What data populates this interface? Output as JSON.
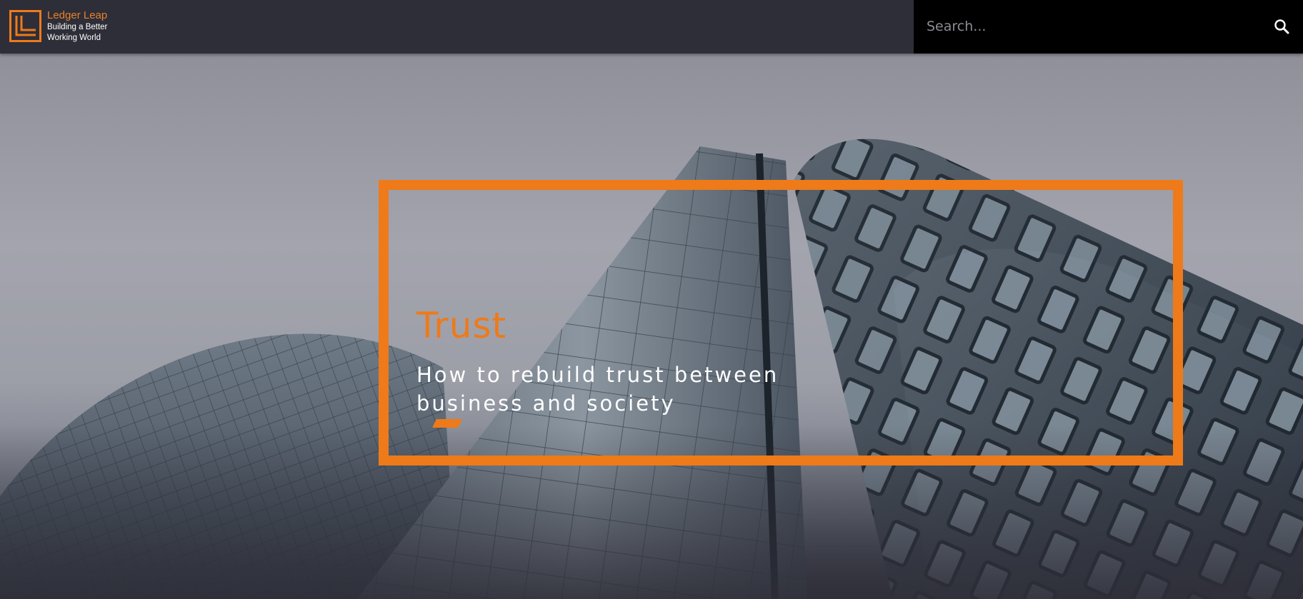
{
  "brand": {
    "name": "Ledger Leap",
    "tagline_line1": "Building a Better",
    "tagline_line2": "Working World",
    "accent_color": "#ee7a1a"
  },
  "search": {
    "placeholder": "Search...",
    "value": "",
    "icon": "search-icon"
  },
  "hero": {
    "title": "Trust",
    "subtitle": "How to rebuild trust between business and society"
  }
}
